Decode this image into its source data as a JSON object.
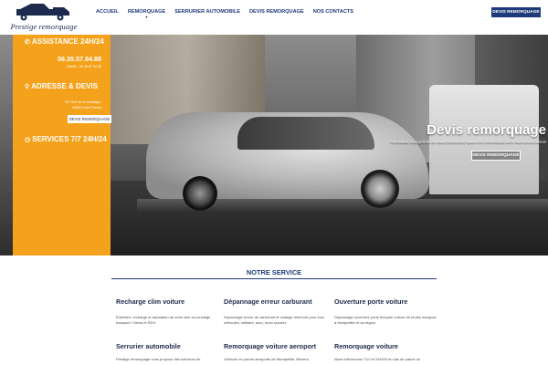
{
  "brand": {
    "logo_text": "Prestige remorquage"
  },
  "nav": {
    "items": [
      "ACCUEIL",
      "REMORQUAGE",
      "SERRURIER AUTOMOBILE",
      "DEVIS REMORQUAGE",
      "NOS CONTACTS"
    ],
    "active_index": 1,
    "cta_label": "DEVIS REMORQUAGE"
  },
  "panel": {
    "assistance_heading": "ASSISTANCE 24H/24",
    "phone_large": "06.35.57.94.88",
    "phone_small": "Mobile : 06 35 57 94 88",
    "address_heading": "ADRESSE & DEVIS",
    "address_line1": "527 Rue de la Carraigue,",
    "address_line2": "34830 Lunel-Franca",
    "devis_button": "DEVIS REMORQUAGE",
    "services_heading": "SERVICES 7/7 24H/24"
  },
  "hero": {
    "title": "Devis remorquage",
    "subtitle": "Formulaire vous permet de nous transmettre toutes les informations dont nous avons besoin",
    "button_label": "DEVIS REMORQUAGE"
  },
  "services": {
    "title": "NOTRE SERVICE",
    "items": [
      {
        "title": "Recharge clim voiture",
        "desc": "Entretien, recharge et réparation de votre clim sur prestige transport ! Devis et RDV."
      },
      {
        "title": "Dépannage erreur carburant",
        "desc": "Dépannage erreur de carburant et vidange réservoir pour tous véhicules, utilitaire, auto, moto scooter."
      },
      {
        "title": "Ouverture porte voiture",
        "desc": "Dépannage ouverture porte bloquée voiture de toutes marques à Montpellier et sa région"
      },
      {
        "title": "Serrurier automobile",
        "desc": "Prestige remorquage vous propose des solutions de"
      },
      {
        "title": "Remorquage voiture aeroport",
        "desc": "Véhicule en panne aéroports de Montpellier, Béziers,"
      },
      {
        "title": "Remorquage voiture",
        "desc": "Nous intervenons 7J/J et 24H/24 en cas de panne ou"
      }
    ]
  },
  "colors": {
    "accent_orange": "#f4a21c",
    "brand_navy": "#1d3a7a"
  }
}
